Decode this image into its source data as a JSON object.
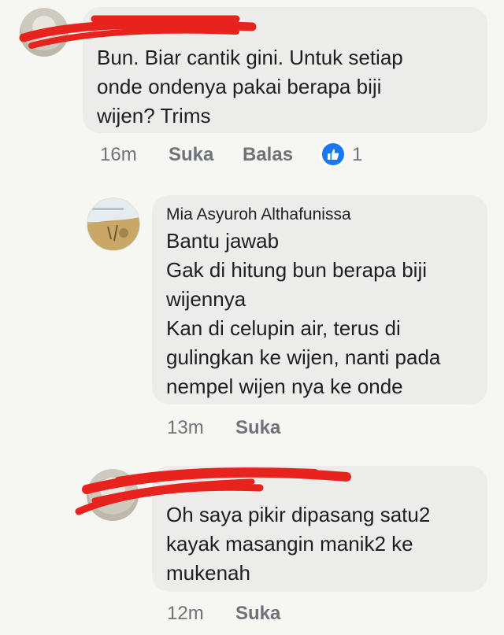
{
  "comments": [
    {
      "author": "",
      "text": "Bun. Biar cantik gini. Untuk setiap\nonde ondenya pakai berapa biji\nwijen? Trims",
      "time": "16m",
      "like_label": "Suka",
      "reply_label": "Balas",
      "reaction_count": "1",
      "redacted": true
    },
    {
      "author": "Mia Asyuroh Althafunissa",
      "text": "Bantu jawab\nGak di hitung bun berapa biji\nwijennya\nKan di celupin air, terus di\ngulingkan ke wijen, nanti pada\nnempel wijen nya ke onde",
      "time": "13m",
      "like_label": "Suka",
      "redacted": false
    },
    {
      "author": "",
      "text": "Oh saya pikir dipasang satu2\nkayak masangin manik2 ke\nmukenah",
      "time": "12m",
      "like_label": "Suka",
      "redacted": true
    }
  ],
  "colors": {
    "background": "#f6f7f2",
    "bubble": "#ecedea",
    "meta_text": "#6f7278",
    "like_blue": "#1877f2",
    "redaction": "#e8231e"
  },
  "icons": {
    "reaction": "thumbs-up-icon"
  }
}
